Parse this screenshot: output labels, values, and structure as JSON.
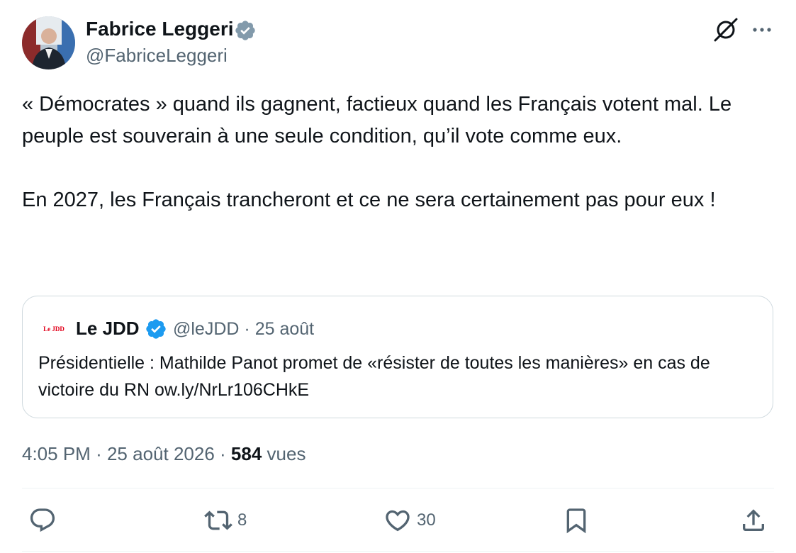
{
  "author": {
    "name": "Fabrice Leggeri",
    "handle": "@FabriceLeggeri"
  },
  "icons": {
    "verified_author": "verified-badge-icon",
    "grok": "grok-icon",
    "more": "more-options-icon",
    "verified_quote": "verified-badge-icon",
    "reply": "reply-icon",
    "retweet": "retweet-icon",
    "like": "like-icon",
    "bookmark": "bookmark-icon",
    "share": "share-icon"
  },
  "tweet": {
    "paragraph_1": "« Démocrates » quand ils gagnent, factieux quand les Français votent mal. Le peuple est souverain à une seule condition, qu’il vote comme eux.",
    "paragraph_2": "En 2027, les Français trancheront et ce ne sera certainement pas pour eux !"
  },
  "quote": {
    "logo_text": "Le JDD",
    "name": "Le JDD",
    "handle": "@leJDD",
    "separator": "·",
    "date": "25 août",
    "text": "Présidentielle : Mathilde Panot promet de «résister de toutes les manières» en cas de victoire du RN ow.ly/NrLr106CHkE"
  },
  "meta": {
    "time": "4:05 PM",
    "separator": "·",
    "date": "25 août 2026",
    "views_count": "584",
    "views_label": "vues"
  },
  "actions": {
    "reply_count": "",
    "retweet_count": "8",
    "like_count": "30"
  },
  "colors": {
    "text_primary": "#0f1419",
    "text_secondary": "#536471",
    "verified_blue": "#1d9bf0",
    "verified_grey": "#829aab",
    "border": "#cfd9de",
    "jdd_red": "#e2001a"
  }
}
